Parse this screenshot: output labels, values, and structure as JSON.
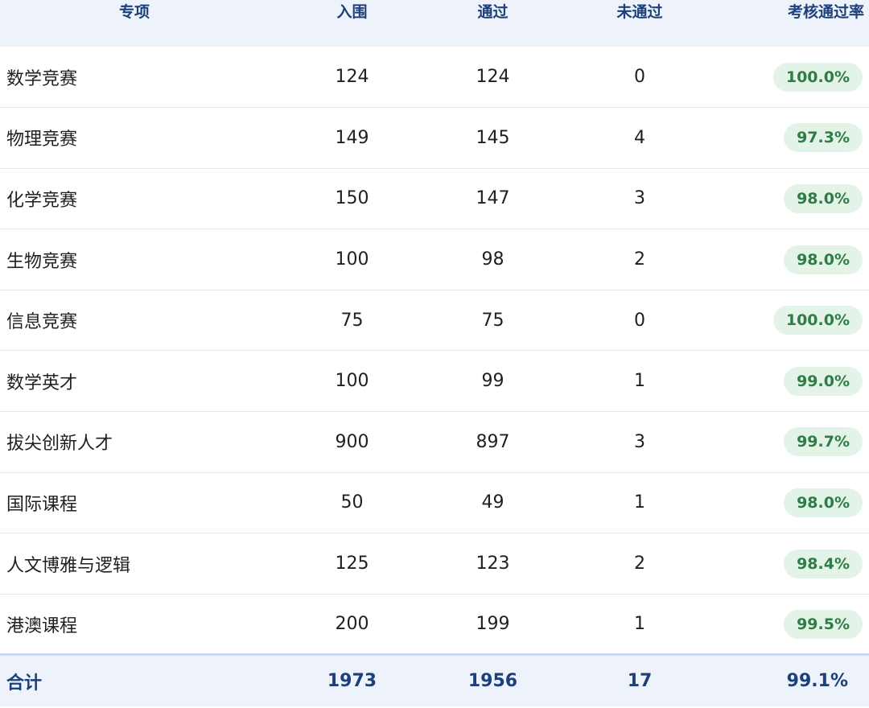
{
  "header": {
    "name": "专项",
    "admitted": "入围",
    "passed": "通过",
    "failed": "未通过",
    "rate": "考核通过率"
  },
  "rows": [
    {
      "name": "数学竞赛",
      "admitted": "124",
      "passed": "124",
      "failed": "0",
      "rate": "100.0%"
    },
    {
      "name": "物理竞赛",
      "admitted": "149",
      "passed": "145",
      "failed": "4",
      "rate": "97.3%"
    },
    {
      "name": "化学竞赛",
      "admitted": "150",
      "passed": "147",
      "failed": "3",
      "rate": "98.0%"
    },
    {
      "name": "生物竞赛",
      "admitted": "100",
      "passed": "98",
      "failed": "2",
      "rate": "98.0%"
    },
    {
      "name": "信息竞赛",
      "admitted": "75",
      "passed": "75",
      "failed": "0",
      "rate": "100.0%"
    },
    {
      "name": "数学英才",
      "admitted": "100",
      "passed": "99",
      "failed": "1",
      "rate": "99.0%"
    },
    {
      "name": "拔尖创新人才",
      "admitted": "900",
      "passed": "897",
      "failed": "3",
      "rate": "99.7%"
    },
    {
      "name": "国际课程",
      "admitted": "50",
      "passed": "49",
      "failed": "1",
      "rate": "98.0%"
    },
    {
      "name": "人文博雅与逻辑",
      "admitted": "125",
      "passed": "123",
      "failed": "2",
      "rate": "98.4%"
    },
    {
      "name": "港澳课程",
      "admitted": "200",
      "passed": "199",
      "failed": "1",
      "rate": "99.5%"
    }
  ],
  "footer": {
    "name": "合计",
    "admitted": "1973",
    "passed": "1956",
    "failed": "17",
    "rate": "99.1%"
  },
  "colors": {
    "header_bg": "#eef3fb",
    "header_text": "#1d3f7a",
    "badge_bg": "#e4f3e7",
    "badge_text": "#2e7d46",
    "row_divider": "#e3e8ee"
  }
}
